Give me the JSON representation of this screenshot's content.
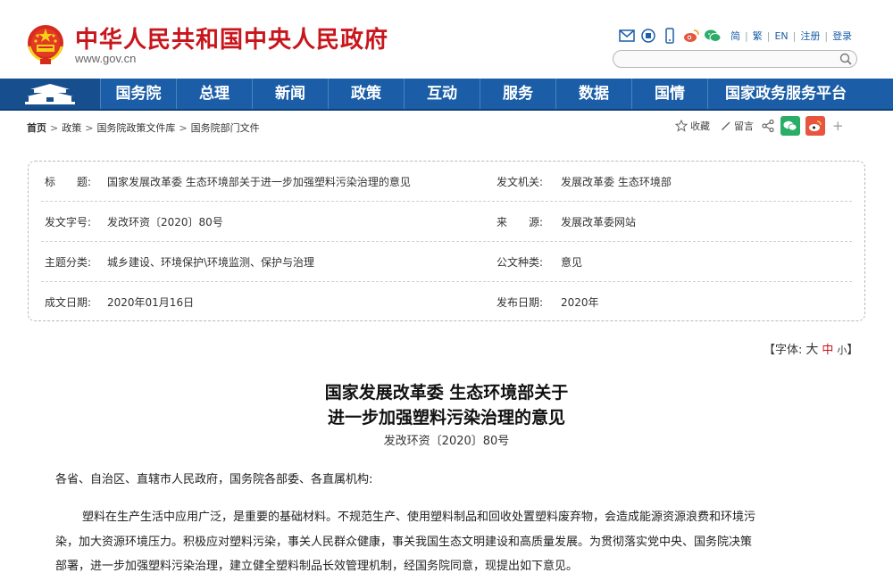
{
  "header": {
    "site_title": "中华人民共和国中央人民政府",
    "site_domain": "www.gov.cn",
    "tool_icons": [
      "mail-icon",
      "app-icon",
      "mobile-icon",
      "weibo-icon",
      "wechat-icon"
    ],
    "lang_links": [
      "简",
      "繁",
      "EN",
      "注册",
      "登录"
    ],
    "search_placeholder": ""
  },
  "nav": {
    "items": [
      "国务院",
      "总理",
      "新闻",
      "政策",
      "互动",
      "服务",
      "数据",
      "国情",
      "国家政务服务平台"
    ]
  },
  "breadcrumb": {
    "items": [
      "首页",
      "政策",
      "国务院政策文件库",
      "国务院部门文件"
    ],
    "separator": ">"
  },
  "actions": {
    "favorite": "收藏",
    "comment": "留言",
    "more": "+"
  },
  "info": {
    "title_label": "标　　题:",
    "title_value": "国家发展改革委 生态环境部关于进一步加强塑料污染治理的意见",
    "issuer_label": "发文机关:",
    "issuer_value": "发展改革委 生态环境部",
    "docno_label": "发文字号:",
    "docno_value": "发改环资〔2020〕80号",
    "source_label": "来　　源:",
    "source_value": "发展改革委网站",
    "topic_label": "主题分类:",
    "topic_value": "城乡建设、环境保护\\环境监测、保护与治理",
    "doctype_label": "公文种类:",
    "doctype_value": "意见",
    "written_label": "成文日期:",
    "written_value": "2020年01月16日",
    "published_label": "发布日期:",
    "published_value": "2020年"
  },
  "fontsize": {
    "prefix": "【字体:",
    "large": "大",
    "medium": "中",
    "small": "小",
    "suffix": "】"
  },
  "article": {
    "title_line1": "国家发展改革委 生态环境部关于",
    "title_line2": "进一步加强塑料污染治理的意见",
    "doc_number": "发改环资〔2020〕80号",
    "addressee": "各省、自治区、直辖市人民政府，国务院各部委、各直属机构:",
    "para_line1": "塑料在生产生活中应用广泛，是重要的基础材料。不规范生产、使用塑料制品和回收处置塑料废弃物，会造成能源资源浪费和环境污",
    "para_line2": "染，加大资源环境压力。积极应对塑料污染，事关人民群众健康，事关我国生态文明建设和高质量发展。为贯彻落实党中央、国务院决策",
    "para_line3": "部署，进一步加强塑料污染治理，建立健全塑料制品长效管理机制，经国务院同意，现提出如下意见。"
  },
  "colors": {
    "brand_red": "#c8161d",
    "nav_blue": "#1b5ea7",
    "link_blue": "#1c5fa8",
    "wechat_green": "#2aae67",
    "weibo_orange": "#e8553e"
  }
}
